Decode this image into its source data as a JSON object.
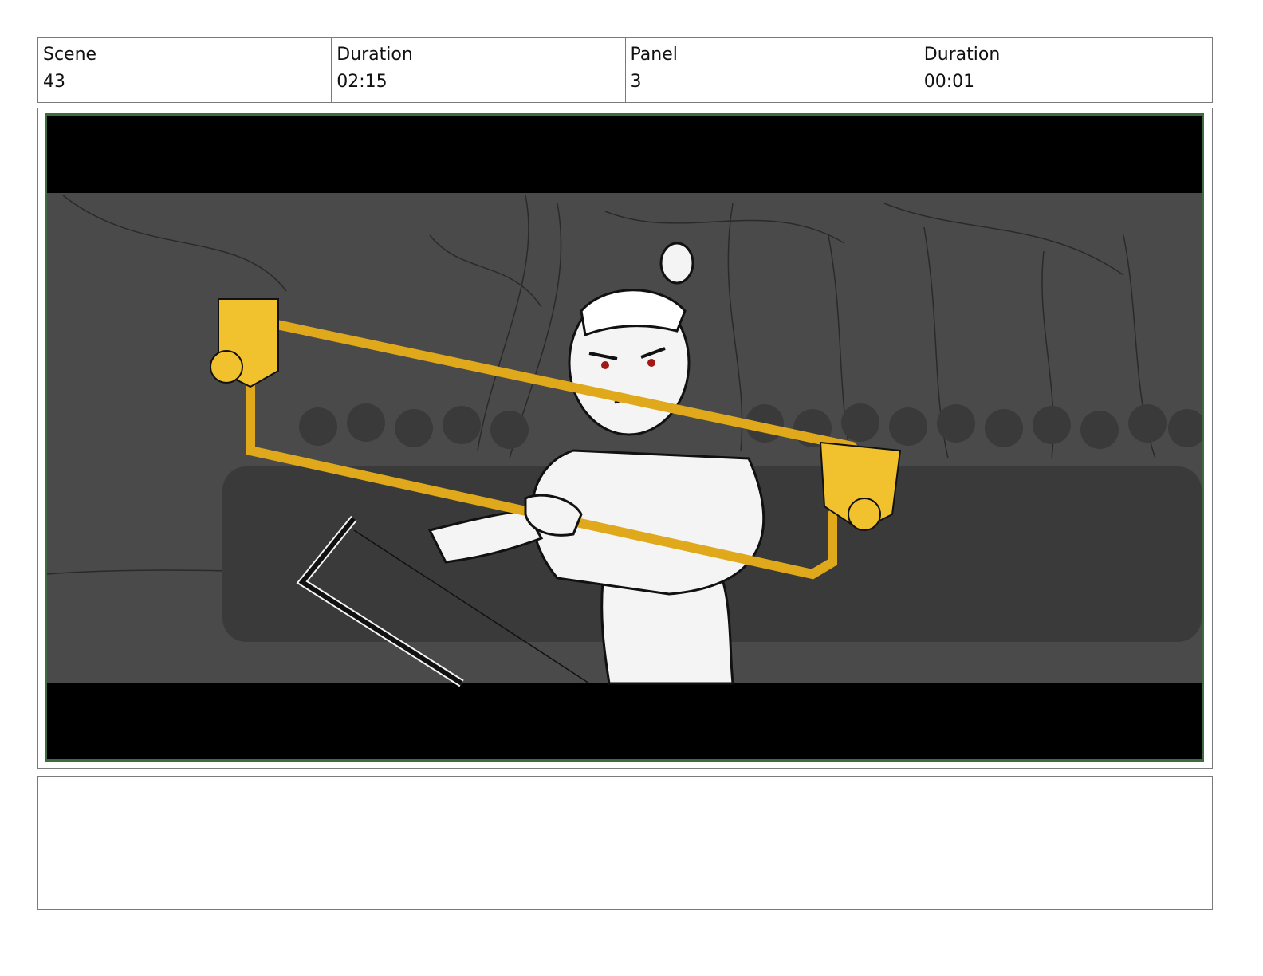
{
  "header": {
    "scene_label": "Scene",
    "scene_value": "43",
    "scene_duration_label": "Duration",
    "scene_duration_value": "02:15",
    "panel_label": "Panel",
    "panel_value": "3",
    "panel_duration_label": "Duration",
    "panel_duration_value": "00:01"
  },
  "colors": {
    "frame_border": "#3f6b3f",
    "letterbox": "#000000",
    "background_gray": "#4a4a4a",
    "crowd_gray": "#3a3a3a",
    "staff_yellow": "#f2c12e"
  },
  "notes": {
    "text": ""
  }
}
